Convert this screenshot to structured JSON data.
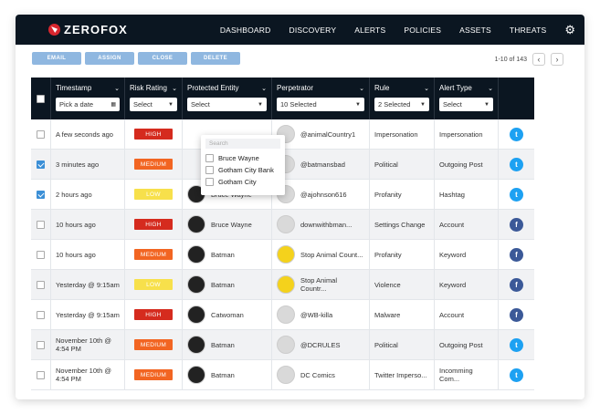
{
  "brand": {
    "name": "ZEROFOX",
    "accent": "#d8262e"
  },
  "nav": [
    "DASHBOARD",
    "DISCOVERY",
    "ALERTS",
    "POLICIES",
    "ASSETS",
    "THREATS"
  ],
  "toolbar": {
    "email": "EMAIL",
    "assign": "ASSIGN",
    "close": "CLOSE",
    "delete": "DELETE"
  },
  "pager": {
    "label": "1-10 of 143",
    "prev": "‹",
    "next": "›"
  },
  "columns": {
    "timestamp": "Timestamp",
    "timestamp_ctrl": "Pick a date",
    "risk": "Risk Rating",
    "risk_ctrl": "Select",
    "entity": "Protected Entity",
    "entity_ctrl": "Select",
    "perp": "Perpetrator",
    "perp_ctrl": "10 Selected",
    "rule": "Rule",
    "rule_ctrl": "2 Selected",
    "type": "Alert Type",
    "type_ctrl": "Select"
  },
  "dropdown": {
    "placeholder": "Search",
    "options": [
      "Bruce Wayne",
      "Gotham City Bank",
      "Gotham City"
    ]
  },
  "colors": {
    "high": "#d52b1e",
    "medium": "#f26522",
    "low": "#f7e04b",
    "twitter": "#1da1f2",
    "facebook": "#3b5998"
  },
  "rows": [
    {
      "time": "A few seconds ago",
      "risk": "HIGH",
      "entity": "",
      "perp": "@animalCountry1",
      "rule": "Impersonation",
      "type": "Impersonation",
      "net": "twitter",
      "checked": false
    },
    {
      "time": "3 minutes ago",
      "risk": "MEDIUM",
      "entity": "",
      "perp": "@batmansbad",
      "rule": "Political",
      "type": "Outgoing Post",
      "net": "twitter",
      "checked": true
    },
    {
      "time": "2 hours ago",
      "risk": "LOW",
      "entity": "Bruce Wayne",
      "perp": "@ajohnson616",
      "rule": "Profanity",
      "type": "Hashtag",
      "net": "twitter",
      "checked": true
    },
    {
      "time": "10 hours ago",
      "risk": "HIGH",
      "entity": "Bruce Wayne",
      "perp": "downwithbman...",
      "rule": "Settings Change",
      "type": "Account",
      "net": "facebook",
      "checked": false
    },
    {
      "time": "10 hours ago",
      "risk": "MEDIUM",
      "entity": "Batman",
      "perp": "Stop Animal Count...",
      "rule": "Profanity",
      "type": "Keyword",
      "net": "facebook",
      "checked": false
    },
    {
      "time": "Yesterday @ 9:15am",
      "risk": "LOW",
      "entity": "Batman",
      "perp": "Stop Animal Countr...",
      "rule": "Violence",
      "type": "Keyword",
      "net": "facebook",
      "checked": false
    },
    {
      "time": "Yesterday @ 9:15am",
      "risk": "HIGH",
      "entity": "Catwoman",
      "perp": "@WB-killa",
      "rule": "Malware",
      "type": "Account",
      "net": "facebook",
      "checked": false
    },
    {
      "time": "November 10th @ 4:54 PM",
      "risk": "MEDIUM",
      "entity": "Batman",
      "perp": "@DCRULES",
      "rule": "Political",
      "type": "Outgoing Post",
      "net": "twitter",
      "checked": false
    },
    {
      "time": "November 10th @ 4:54 PM",
      "risk": "MEDIUM",
      "entity": "Batman",
      "perp": "DC Comics",
      "rule": "Twitter Imperso...",
      "type": "Incomming Com...",
      "net": "twitter",
      "checked": false
    }
  ]
}
